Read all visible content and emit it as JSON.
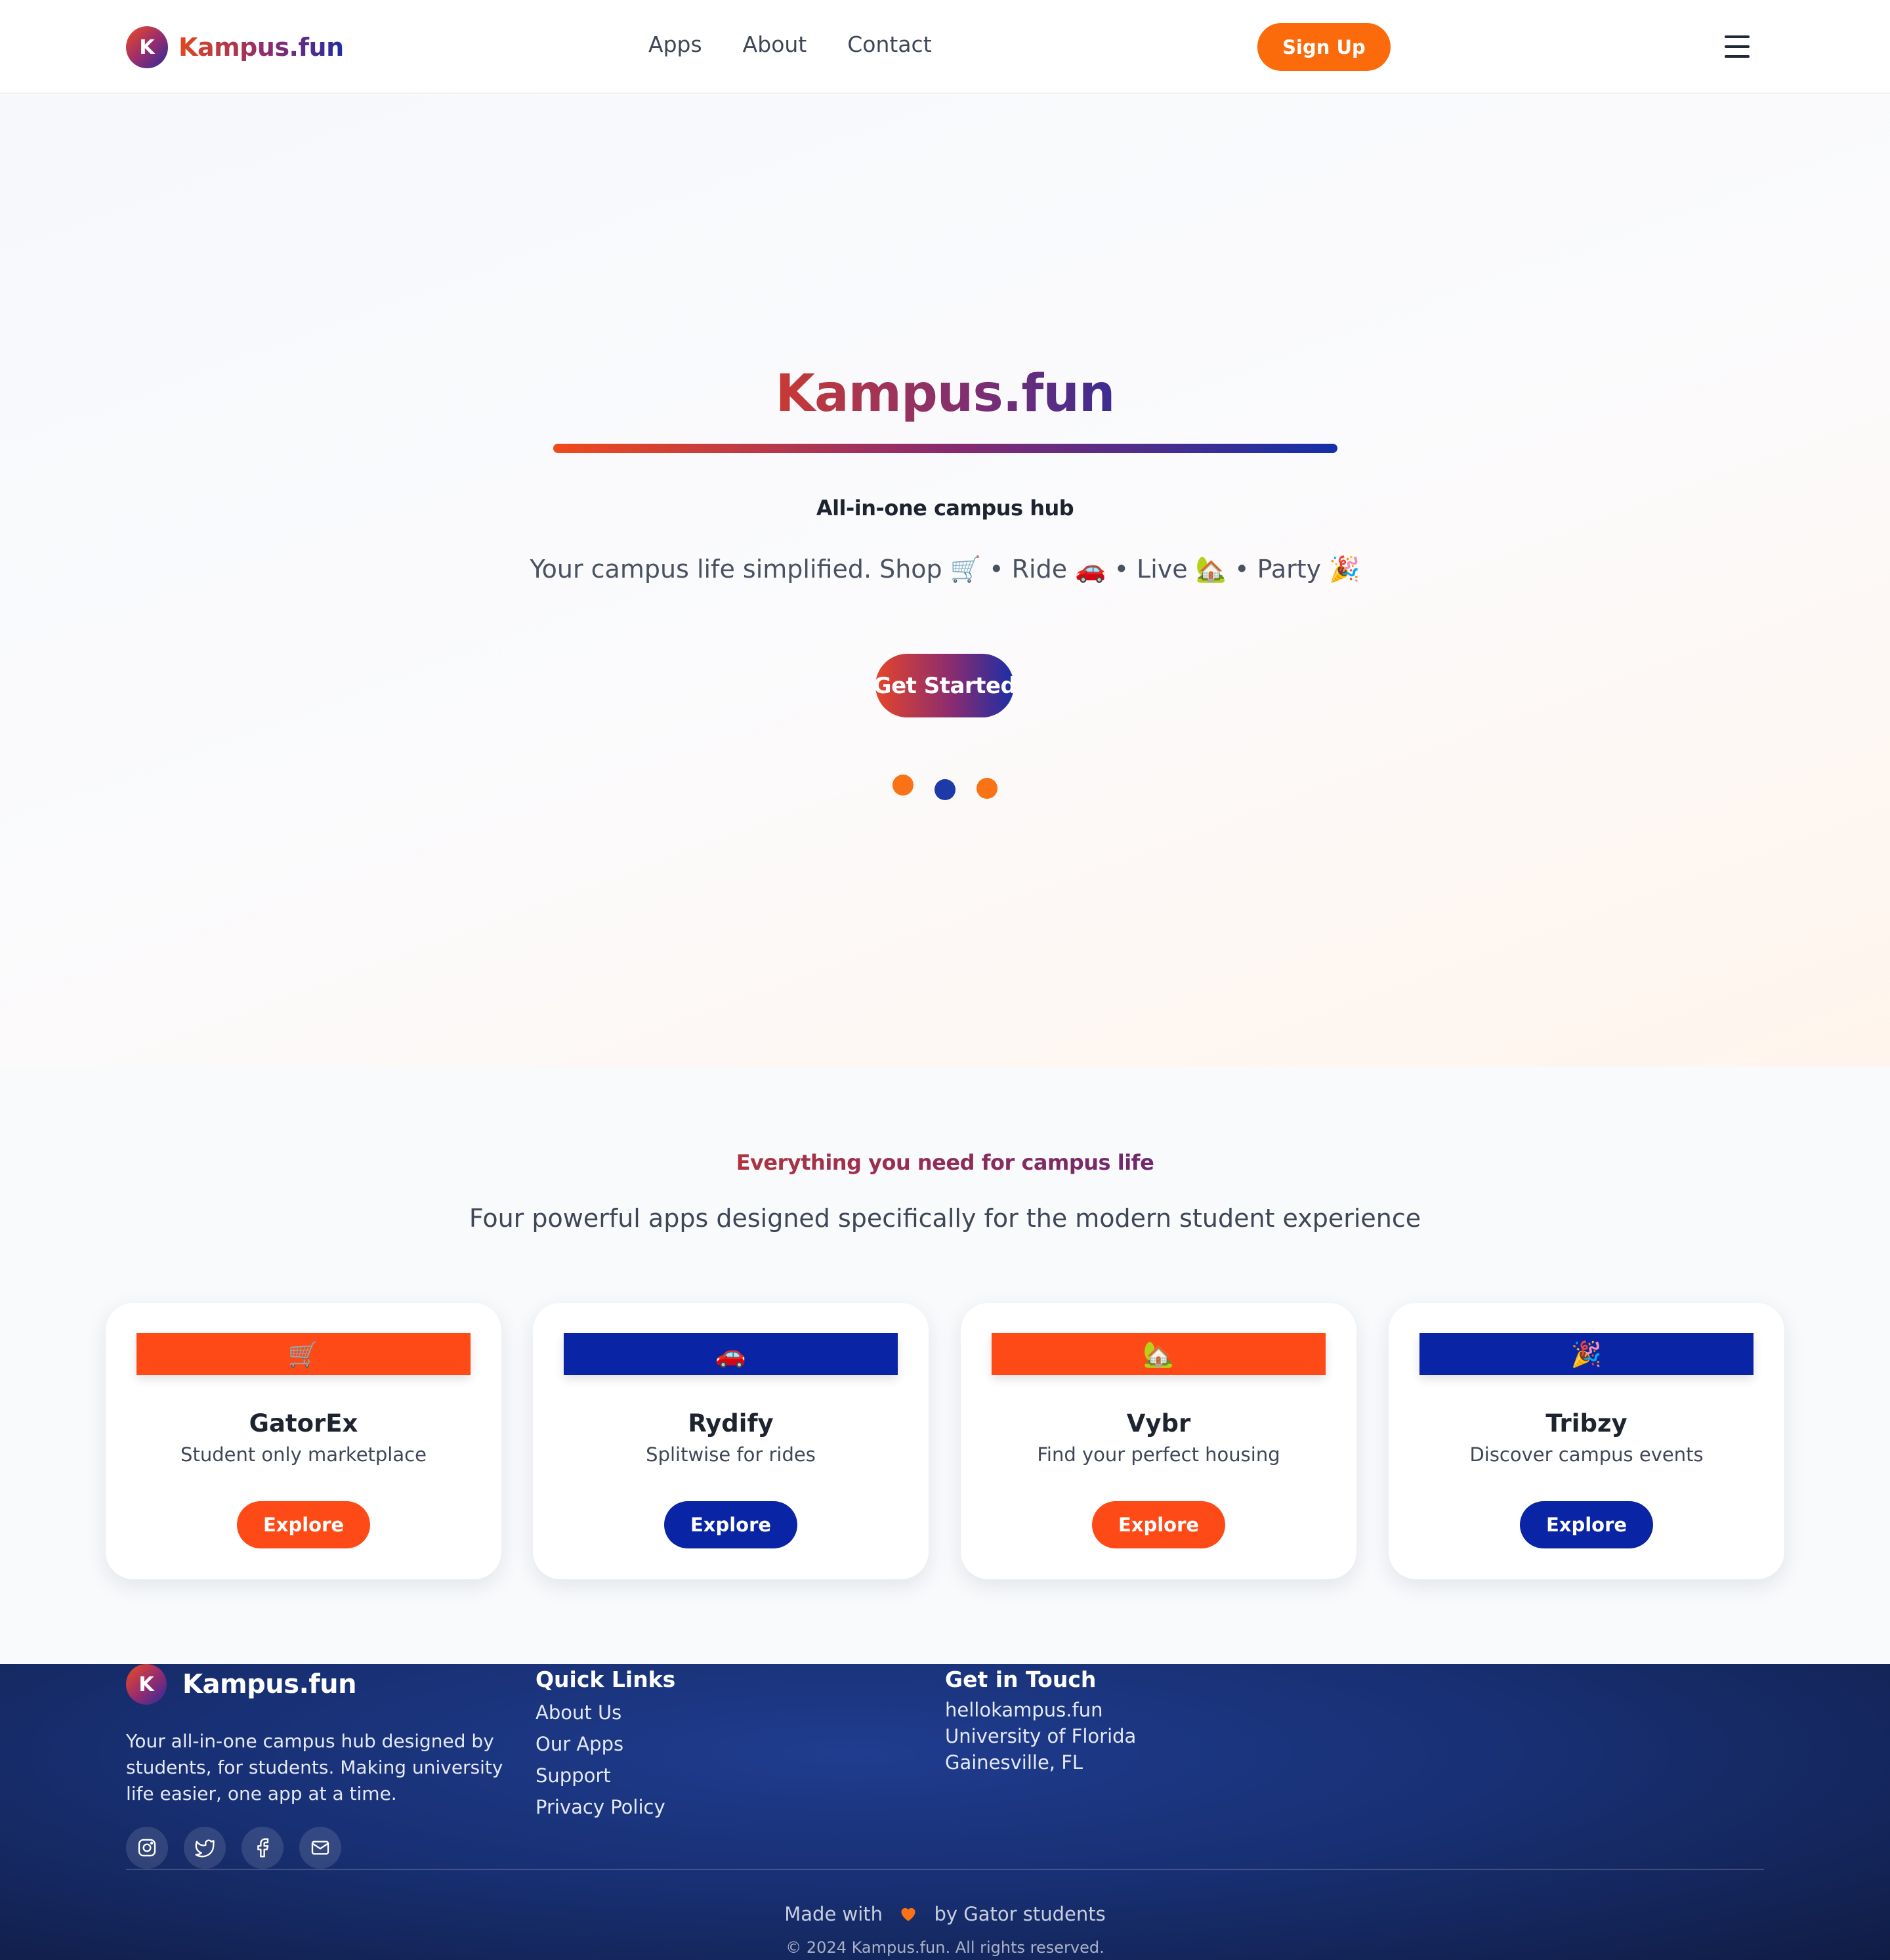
{
  "brand": {
    "badge_letter": "K",
    "name": "Kampus.fun"
  },
  "nav": {
    "items": [
      {
        "label": "Apps"
      },
      {
        "label": "About"
      },
      {
        "label": "Contact"
      }
    ],
    "signup_label": "Sign Up"
  },
  "hero": {
    "title": "Kampus.fun",
    "tagline": "All-in-one campus hub",
    "subtitle": "Your campus life simplified. Shop 🛒 • Ride 🚗 • Live 🏡 • Party 🎉",
    "cta_label": "Get Started",
    "dot_colors": [
      "#f97316",
      "#1e3aa8",
      "#f97316"
    ]
  },
  "apps_section": {
    "heading": "Everything you need for campus life",
    "subheading": "Four powerful apps designed specifically for the modern student experience",
    "apps": [
      {
        "name": "GatorEx",
        "description": "Student only marketplace",
        "emoji": "🛒",
        "color": "#fd4a17",
        "button_label": "Explore"
      },
      {
        "name": "Rydify",
        "description": "Splitwise for rides",
        "emoji": "🚗",
        "color": "#0a24a6",
        "button_label": "Explore"
      },
      {
        "name": "Vybr",
        "description": "Find your perfect housing",
        "emoji": "🏡",
        "color": "#fd4a17",
        "button_label": "Explore"
      },
      {
        "name": "Tribzy",
        "description": "Discover campus events",
        "emoji": "🎉",
        "color": "#0a24a6",
        "button_label": "Explore"
      }
    ]
  },
  "footer": {
    "brand_name": "Kampus.fun",
    "about": "Your all-in-one campus hub designed by students, for students. Making university life easier, one app at a time.",
    "socials": [
      "instagram-icon",
      "twitter-icon",
      "facebook-icon",
      "mail-icon"
    ],
    "quick_links_title": "Quick Links",
    "quick_links": [
      "About Us",
      "Our Apps",
      "Support",
      "Privacy Policy"
    ],
    "contact_title": "Get in Touch",
    "contact_lines": [
      "hellokampus.fun",
      "University of Florida",
      "Gainesville, FL"
    ],
    "made_with_prefix": "Made with",
    "made_with_suffix": "by Gator students",
    "heart_color": "#f97316",
    "copyright": "© 2024 Kampus.fun. All rights reserved."
  }
}
